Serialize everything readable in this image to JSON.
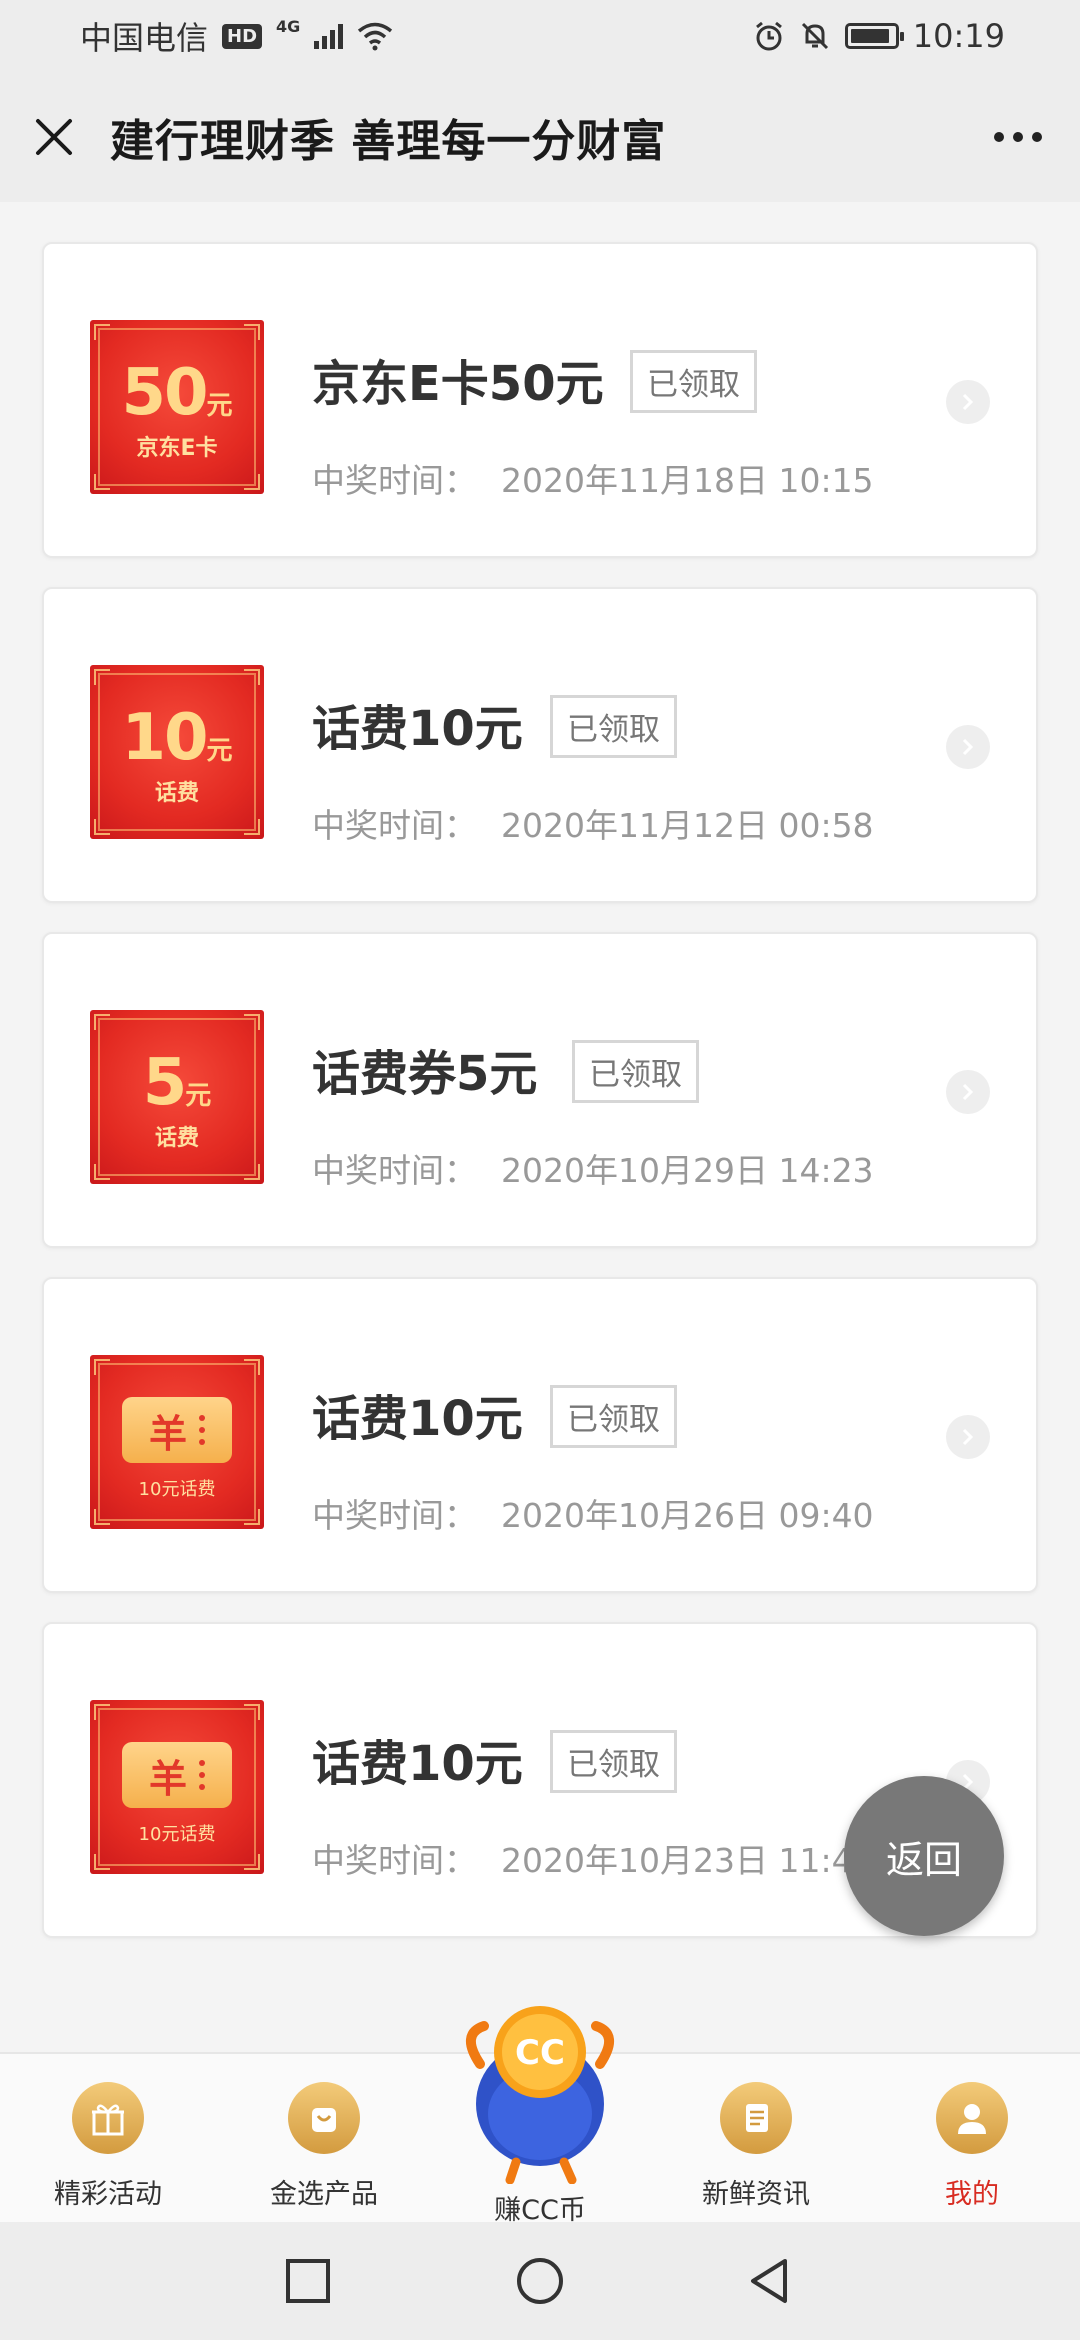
{
  "status_bar": {
    "carrier": "中国电信",
    "hd": "HD",
    "network": "4G",
    "time": "10:19",
    "battery_level": 0.9
  },
  "header": {
    "title": "建行理财季 善理每一分财富",
    "close_icon": "close-icon",
    "more_icon": "more-dots-icon"
  },
  "time_label": "中奖时间：",
  "prizes": [
    {
      "name": "京东E卡50元",
      "status": "已领取",
      "time": "2020年11月18日 10:15",
      "img_amount": "50",
      "img_unit": "元",
      "img_sub": "京东E卡",
      "img_type": "amount"
    },
    {
      "name": "话费10元",
      "status": "已领取",
      "time": "2020年11月12日 00:58",
      "img_amount": "10",
      "img_unit": "元",
      "img_sub": "话费",
      "img_type": "amount"
    },
    {
      "name": "话费券5元",
      "status": "已领取",
      "time": "2020年10月29日 14:23",
      "img_amount": "5",
      "img_unit": "元",
      "img_sub": "话费",
      "img_type": "amount"
    },
    {
      "name": "话费10元",
      "status": "已领取",
      "time": "2020年10月26日 09:40",
      "img_symbol": "羊",
      "img_sub": "10元话费",
      "img_type": "ticket"
    },
    {
      "name": "话费10元",
      "status": "已领取",
      "time": "2020年10月23日 11:45",
      "img_symbol": "羊",
      "img_sub": "10元话费",
      "img_type": "ticket"
    }
  ],
  "back_button": "返回",
  "tabs": [
    {
      "label": "精彩活动",
      "icon": "gift-icon"
    },
    {
      "label": "金选产品",
      "icon": "bag-icon"
    },
    {
      "label": "赚CC币",
      "icon": "cc-mascot-icon",
      "mascot_text": "CC"
    },
    {
      "label": "新鲜资讯",
      "icon": "news-icon"
    },
    {
      "label": "我的",
      "icon": "user-icon",
      "active": true
    }
  ],
  "colors": {
    "accent_red": "#d82c22",
    "gold": "#e0ad55",
    "fab": "#787878"
  }
}
